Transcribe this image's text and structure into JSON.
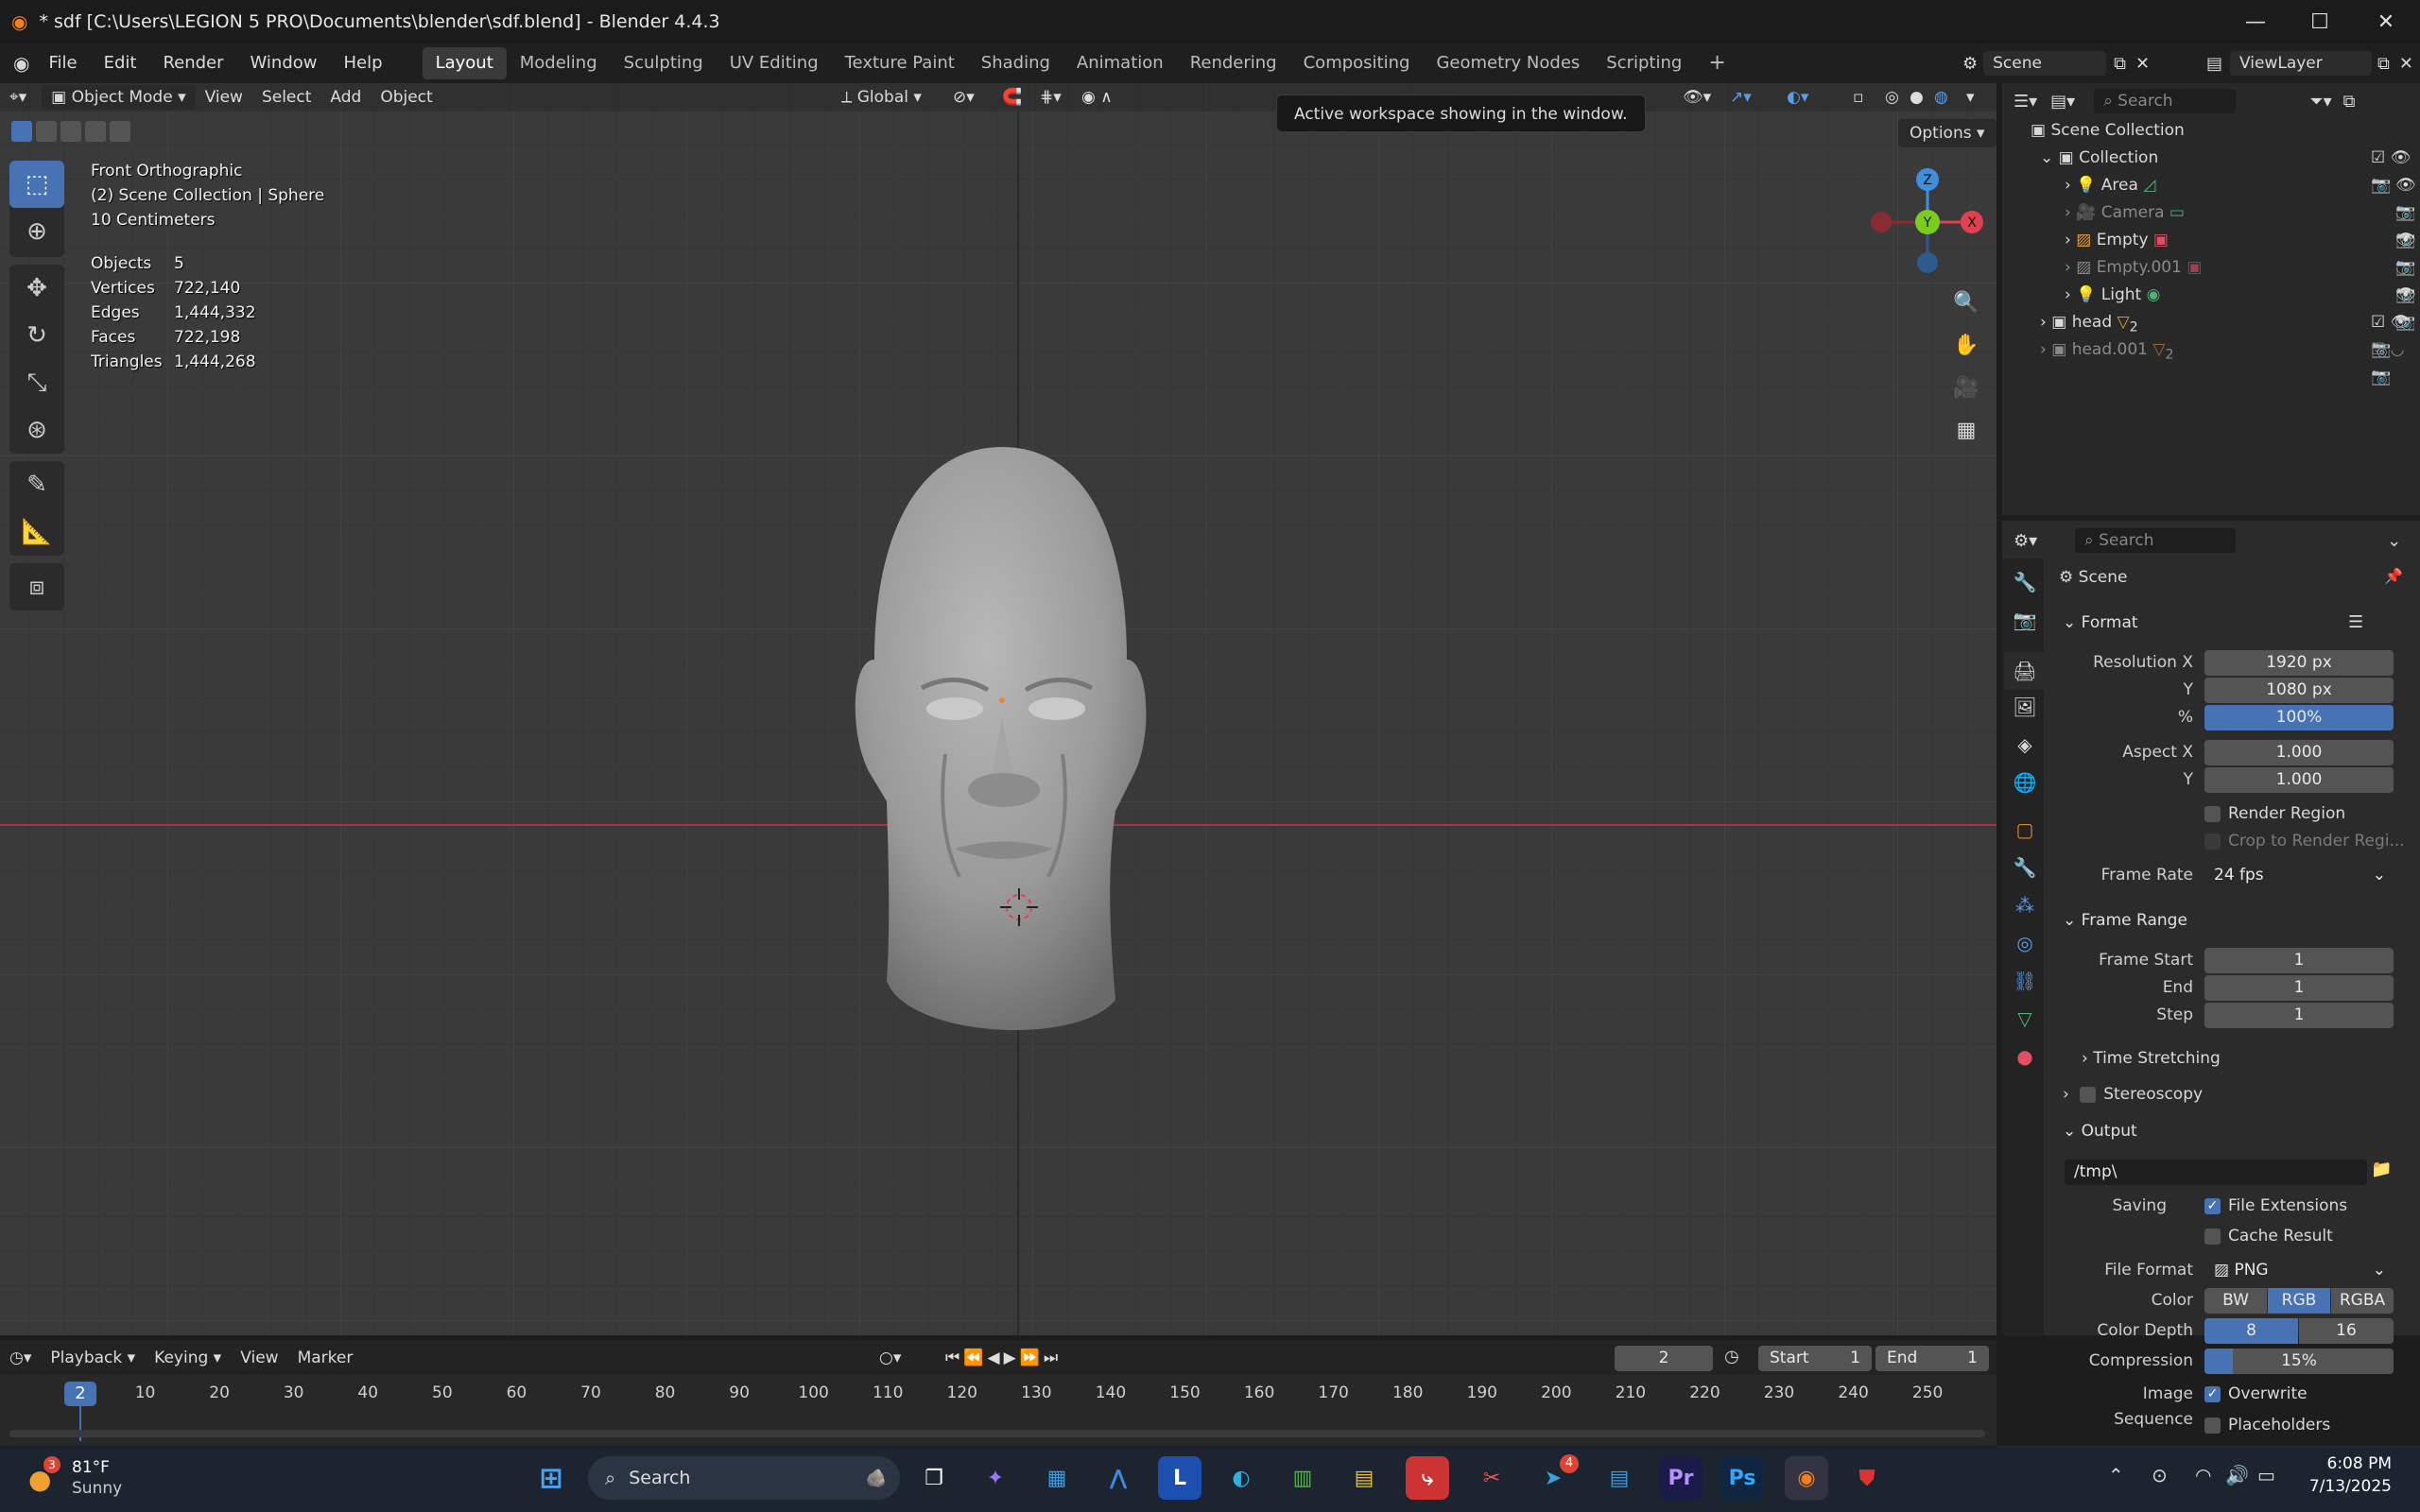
{
  "window": {
    "title": "* sdf [C:\\Users\\LEGION 5 PRO\\Documents\\blender\\sdf.blend] - Blender 4.4.3"
  },
  "menu": [
    "File",
    "Edit",
    "Render",
    "Window",
    "Help"
  ],
  "workspaces": [
    "Layout",
    "Modeling",
    "Sculpting",
    "UV Editing",
    "Texture Paint",
    "Shading",
    "Animation",
    "Rendering",
    "Compositing",
    "Geometry Nodes",
    "Scripting"
  ],
  "scene_selector": {
    "scene": "Scene",
    "view_layer": "ViewLayer"
  },
  "viewport": {
    "mode": "Object Mode",
    "menus": [
      "View",
      "Select",
      "Add",
      "Object"
    ],
    "orientation": "Global",
    "options_label": "Options",
    "tooltip": "Active workspace showing in the window.",
    "overlay": {
      "view_name": "Front Orthographic",
      "collection": "(2) Scene Collection | Sphere",
      "scale": "10 Centimeters",
      "stats": [
        {
          "label": "Objects",
          "value": "5"
        },
        {
          "label": "Vertices",
          "value": "722,140"
        },
        {
          "label": "Edges",
          "value": "1,444,332"
        },
        {
          "label": "Faces",
          "value": "722,198"
        },
        {
          "label": "Triangles",
          "value": "1,444,268"
        }
      ]
    },
    "gizmo": {
      "z": "Z",
      "y": "Y",
      "x": "X"
    }
  },
  "outliner": {
    "search_placeholder": "Search",
    "root": "Scene Collection",
    "items": [
      {
        "name": "Collection"
      },
      {
        "name": "Area"
      },
      {
        "name": "Camera"
      },
      {
        "name": "Empty"
      },
      {
        "name": "Empty.001"
      },
      {
        "name": "Light"
      },
      {
        "name": "head",
        "badge": "2"
      },
      {
        "name": "head.001",
        "badge": "2"
      }
    ]
  },
  "properties": {
    "search_placeholder": "Search",
    "context": "Scene",
    "format": {
      "title": "Format",
      "resolution_x_label": "Resolution X",
      "resolution_x": "1920 px",
      "y_label": "Y",
      "resolution_y": "1080 px",
      "pct_label": "%",
      "pct": "100%",
      "aspect_x_label": "Aspect X",
      "aspect_x": "1.000",
      "aspect_y_label": "Y",
      "aspect_y": "1.000",
      "render_region": "Render Region",
      "crop": "Crop to Render Regi...",
      "frame_rate_label": "Frame Rate",
      "frame_rate": "24 fps"
    },
    "frame_range": {
      "title": "Frame Range",
      "start_label": "Frame Start",
      "start": "1",
      "end_label": "End",
      "end": "1",
      "step_label": "Step",
      "step": "1",
      "time_stretching": "Time Stretching"
    },
    "stereoscopy": "Stereoscopy",
    "output": {
      "title": "Output",
      "path": "/tmp\\",
      "saving_label": "Saving",
      "file_extensions": "File Extensions",
      "cache_result": "Cache Result",
      "file_format_label": "File Format",
      "file_format": "PNG",
      "color_label": "Color",
      "color_opts": [
        "BW",
        "RGB",
        "RGBA"
      ],
      "depth_label": "Color Depth",
      "depth_opts": [
        "8",
        "16"
      ],
      "compression_label": "Compression",
      "compression": "15%",
      "compression_fraction": 0.15,
      "image_sequence_label": "Image Sequence",
      "overwrite": "Overwrite",
      "placeholders": "Placeholders"
    }
  },
  "timeline": {
    "menus": [
      "Playback",
      "Keying",
      "View",
      "Marker"
    ],
    "current_frame": "2",
    "start_label": "Start",
    "start": "1",
    "end_label": "End",
    "end": "1",
    "ruler": [
      "10",
      "20",
      "30",
      "40",
      "50",
      "60",
      "70",
      "80",
      "90",
      "100",
      "110",
      "120",
      "130",
      "140",
      "150",
      "160",
      "170",
      "180",
      "190",
      "200",
      "210",
      "220",
      "230",
      "240",
      "250"
    ],
    "playhead": "2"
  },
  "taskbar": {
    "weather_temp": "81°F",
    "weather_text": "Sunny",
    "weather_badge": "3",
    "search_label": "Search",
    "telegram_badge": "4",
    "time": "6:08 PM",
    "date": "7/13/2025"
  },
  "colors": {
    "accent": "#4772b3",
    "axis_x": "#e0404f",
    "axis_y": "#7ccc1e",
    "axis_z": "#3f8fe0"
  }
}
